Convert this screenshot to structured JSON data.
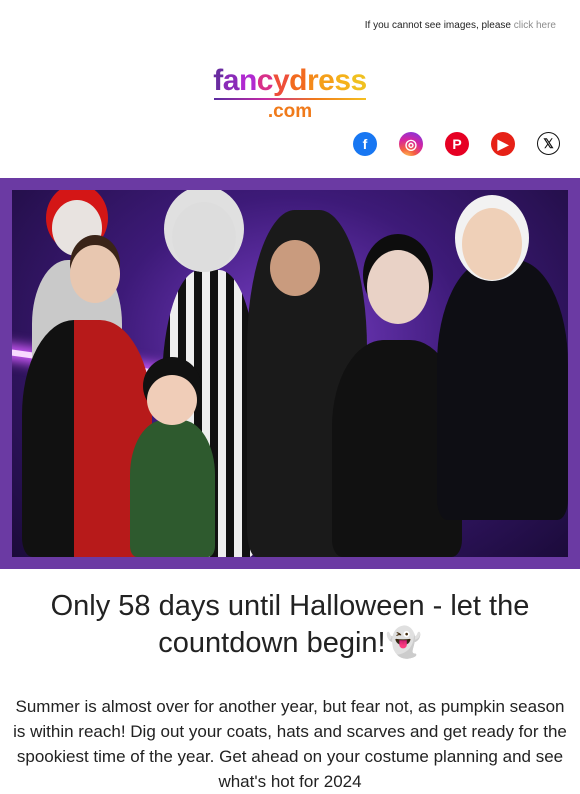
{
  "header": {
    "notice_text": "If you cannot see images, please",
    "notice_link": "click here"
  },
  "logo": {
    "main_letters": [
      "f",
      "a",
      "n",
      "c",
      "y",
      "d",
      "r",
      "e",
      "s",
      "s"
    ],
    "domain": ".com"
  },
  "social": [
    {
      "name": "facebook",
      "glyph": "f"
    },
    {
      "name": "instagram",
      "glyph": "◎"
    },
    {
      "name": "pinterest",
      "glyph": "P"
    },
    {
      "name": "youtube",
      "glyph": "▶"
    },
    {
      "name": "x",
      "glyph": "𝕏"
    }
  ],
  "main": {
    "headline": "Only 58 days until Halloween - let the countdown begin!👻",
    "paragraph": "Summer is almost over for another year, but fear not, as pumpkin season is within reach! Dig out your coats, hats and scarves and get ready for the spookiest time of the year. Get ahead on your costume planning and see what's hot for 2024"
  },
  "colors": {
    "hero_frame": "#6b3aa3",
    "link_gray": "#8c8c8c",
    "facebook": "#1877f2",
    "pinterest": "#e60023",
    "youtube": "#e62117"
  }
}
